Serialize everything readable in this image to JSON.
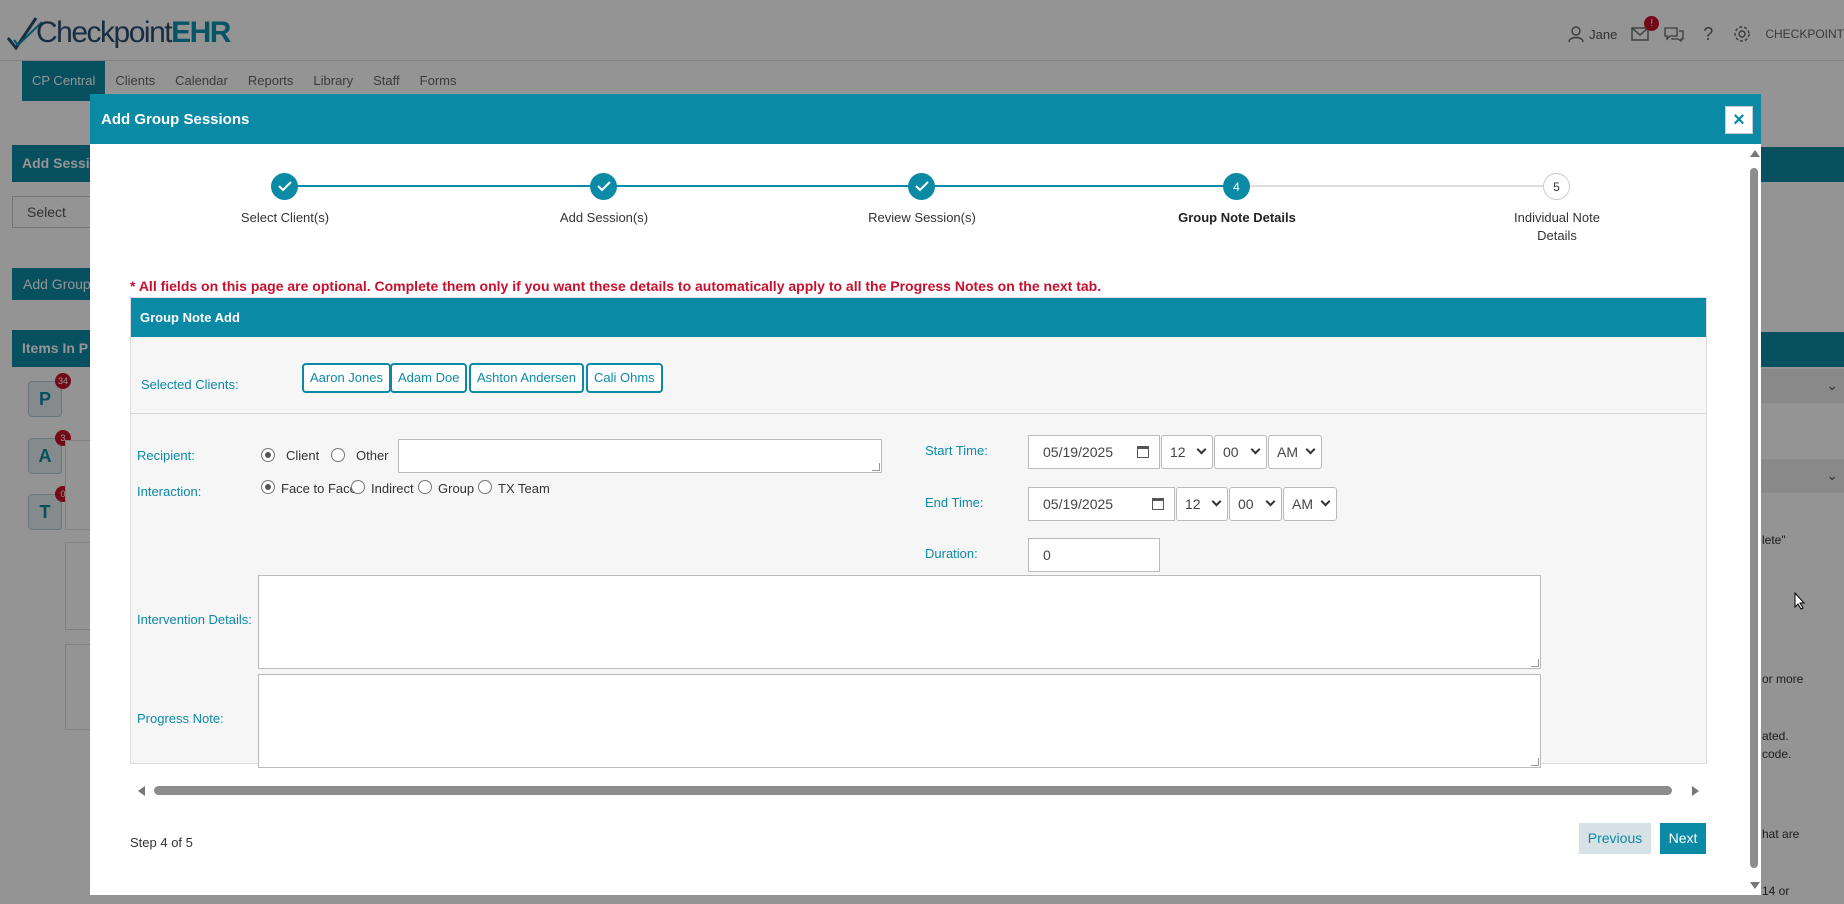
{
  "app": {
    "brand_prefix": "Checkpoint",
    "brand_suffix": "EHR",
    "user_name": "Jane",
    "mail_badge": "!",
    "org_name": "CHECKPOINT"
  },
  "nav": {
    "items": [
      "CP Central",
      "Clients",
      "Calendar",
      "Reports",
      "Library",
      "Staff",
      "Forms"
    ]
  },
  "background": {
    "panel1_title": "Add Sessio",
    "select_label": "Select",
    "add_group_btn": "Add Group",
    "panel2_title": "Items In P",
    "tiles": [
      {
        "letter": "P",
        "count": "34"
      },
      {
        "letter": "A",
        "count": "3"
      },
      {
        "letter": "T",
        "count": "0"
      }
    ],
    "right_texts": [
      "lete\"",
      "or more",
      "ated.",
      "code.",
      "hat are",
      "14 or"
    ]
  },
  "modal": {
    "title": "Add Group Sessions",
    "close_label": "×",
    "steps": [
      {
        "number": "1",
        "label": "Select Client(s)",
        "status": "done"
      },
      {
        "number": "2",
        "label": "Add Session(s)",
        "status": "done"
      },
      {
        "number": "3",
        "label": "Review Session(s)",
        "status": "done"
      },
      {
        "number": "4",
        "label": "Group Note Details",
        "status": "current"
      },
      {
        "number": "5",
        "label": "Individual Note Details",
        "status": "todo"
      }
    ],
    "notice": "* All fields on this page are optional. Complete them only if you want these details to automatically apply to all the Progress Notes on the next tab.",
    "form_title": "Group Note Add",
    "selected_clients_label": "Selected Clients:",
    "clients": [
      "Aaron Jones",
      "Adam Doe",
      "Ashton Andersen",
      "Cali Ohms"
    ],
    "recipient": {
      "label": "Recipient:",
      "options": [
        "Client",
        "Other"
      ],
      "selected": "Client",
      "other_value": ""
    },
    "interaction": {
      "label": "Interaction:",
      "options": [
        "Face to Face",
        "Indirect",
        "Group",
        "TX Team"
      ],
      "selected": "Face to Face"
    },
    "start_time": {
      "label": "Start Time:",
      "date": "05/19/2025",
      "hour": "12",
      "minute": "00",
      "ampm": "AM"
    },
    "end_time": {
      "label": "End Time:",
      "date": "05/19/2025",
      "hour": "12",
      "minute": "00",
      "ampm": "AM"
    },
    "duration": {
      "label": "Duration:",
      "value": "0"
    },
    "intervention_label": "Intervention Details:",
    "progress_label": "Progress Note:",
    "step_count": "Step 4 of 5",
    "prev_label": "Previous",
    "next_label": "Next"
  },
  "colors": {
    "accent": "#0b8aa6",
    "notice": "#c8102e",
    "badge": "#c8102e"
  }
}
